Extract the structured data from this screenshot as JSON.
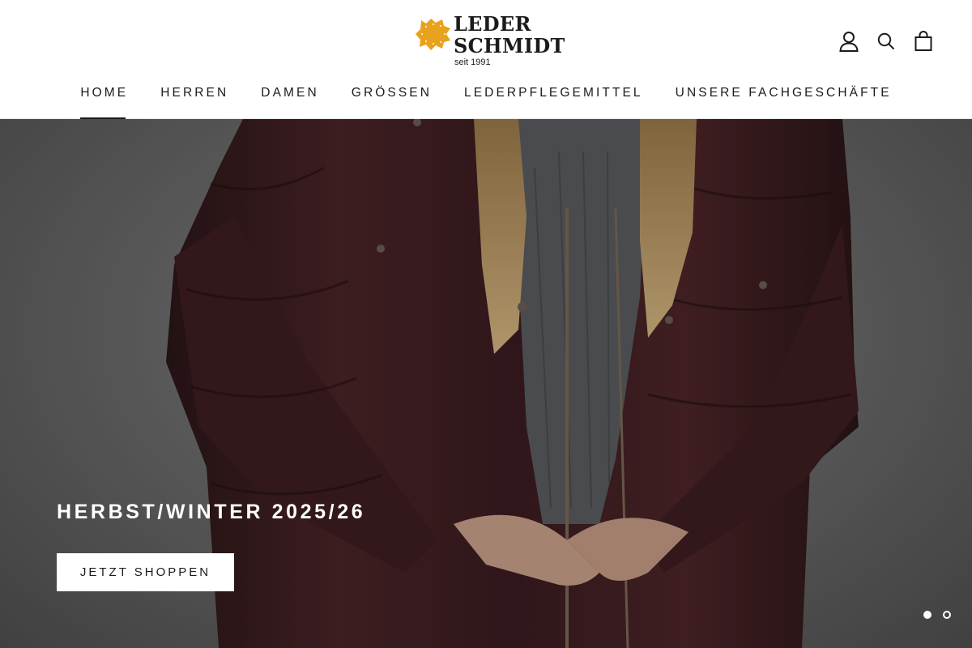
{
  "brand": {
    "line1": "LEDER",
    "line2": "SCHMIDT",
    "since": "seit 1991",
    "accent_color": "#e8a21c"
  },
  "header": {
    "icons": [
      "account-icon",
      "search-icon",
      "cart-icon"
    ]
  },
  "nav": {
    "items": [
      {
        "label": "HOME",
        "active": true
      },
      {
        "label": "HERREN",
        "active": false
      },
      {
        "label": "DAMEN",
        "active": false
      },
      {
        "label": "GRÖSSEN",
        "active": false
      },
      {
        "label": "LEDERPFLEGEMITTEL",
        "active": false
      },
      {
        "label": "UNSERE FACHGESCHÄFTE",
        "active": false
      }
    ]
  },
  "hero": {
    "title": "HERBST/WINTER 2025/26",
    "button_label": "JETZT SHOPPEN",
    "slides": [
      {
        "active": true
      },
      {
        "active": false
      }
    ]
  }
}
